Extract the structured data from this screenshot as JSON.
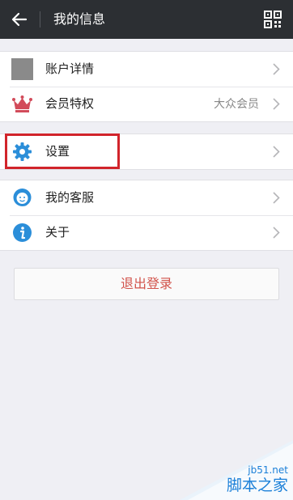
{
  "header": {
    "title": "我的信息",
    "back_icon": "arrow-left-icon",
    "qr_icon": "qr-code-icon"
  },
  "group1": [
    {
      "label": "账户详情",
      "value": "",
      "icon": "avatar-placeholder"
    },
    {
      "label": "会员特权",
      "value": "大众会员",
      "icon": "crown-icon"
    }
  ],
  "group2": [
    {
      "label": "设置",
      "value": "",
      "icon": "gear-icon"
    }
  ],
  "group3": [
    {
      "label": "我的客服",
      "value": "",
      "icon": "customer-service-icon"
    },
    {
      "label": "关于",
      "value": "",
      "icon": "info-icon"
    }
  ],
  "logout_label": "退出登录",
  "watermark": {
    "site": "jb51.net",
    "name": "脚本之家"
  },
  "colors": {
    "header_bg": "#2c2f33",
    "highlight": "#d1242b",
    "logout_text": "#d2534b",
    "icon_blue": "#2b8ed9",
    "crown_red": "#d24b5a"
  }
}
